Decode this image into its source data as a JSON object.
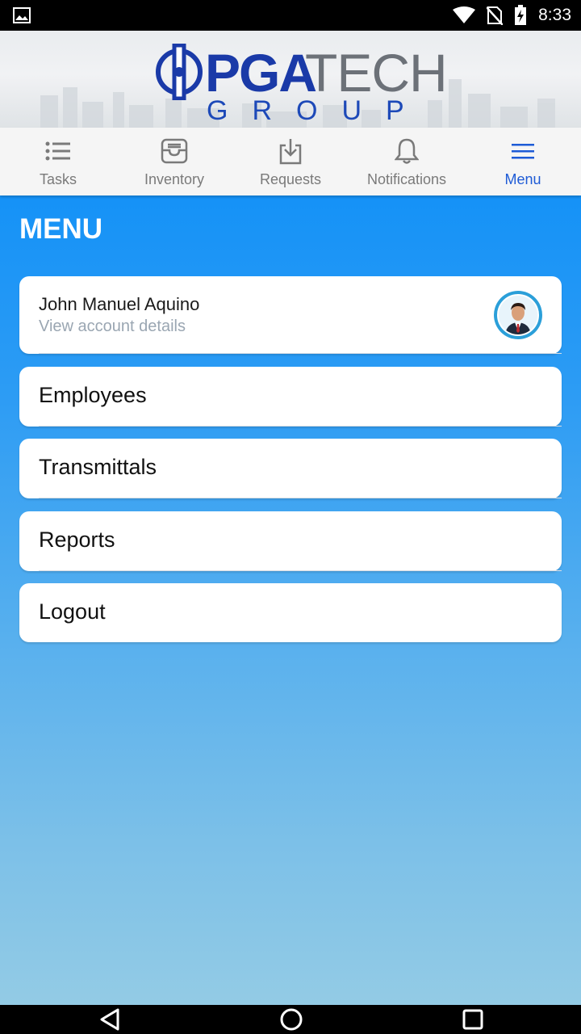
{
  "status_bar": {
    "time": "8:33",
    "icons": [
      "image-notification-icon",
      "wifi-icon",
      "no-sim-icon",
      "battery-charging-icon"
    ]
  },
  "header": {
    "logo_text_primary": "PGA",
    "logo_text_secondary": "TECH",
    "logo_text_group": "GROUP",
    "brand_color": "#1a3aa8"
  },
  "tabs": [
    {
      "label": "Tasks",
      "icon": "list-icon",
      "active": false
    },
    {
      "label": "Inventory",
      "icon": "inbox-icon",
      "active": false
    },
    {
      "label": "Requests",
      "icon": "download-icon",
      "active": false
    },
    {
      "label": "Notifications",
      "icon": "bell-icon",
      "active": false
    },
    {
      "label": "Menu",
      "icon": "hamburger-icon",
      "active": true
    }
  ],
  "menu": {
    "title": "MENU",
    "account": {
      "name": "John Manuel Aquino",
      "subtitle": "View account details"
    },
    "items": [
      {
        "label": "Employees"
      },
      {
        "label": "Transmittals"
      },
      {
        "label": "Reports"
      },
      {
        "label": "Logout"
      }
    ]
  },
  "colors": {
    "accent": "#1e5bd6",
    "main_bg_top": "#1592f7",
    "main_bg_bottom": "#93cbe5"
  },
  "nav_bar": {
    "icons": [
      "back-icon",
      "home-icon",
      "recents-icon"
    ]
  }
}
